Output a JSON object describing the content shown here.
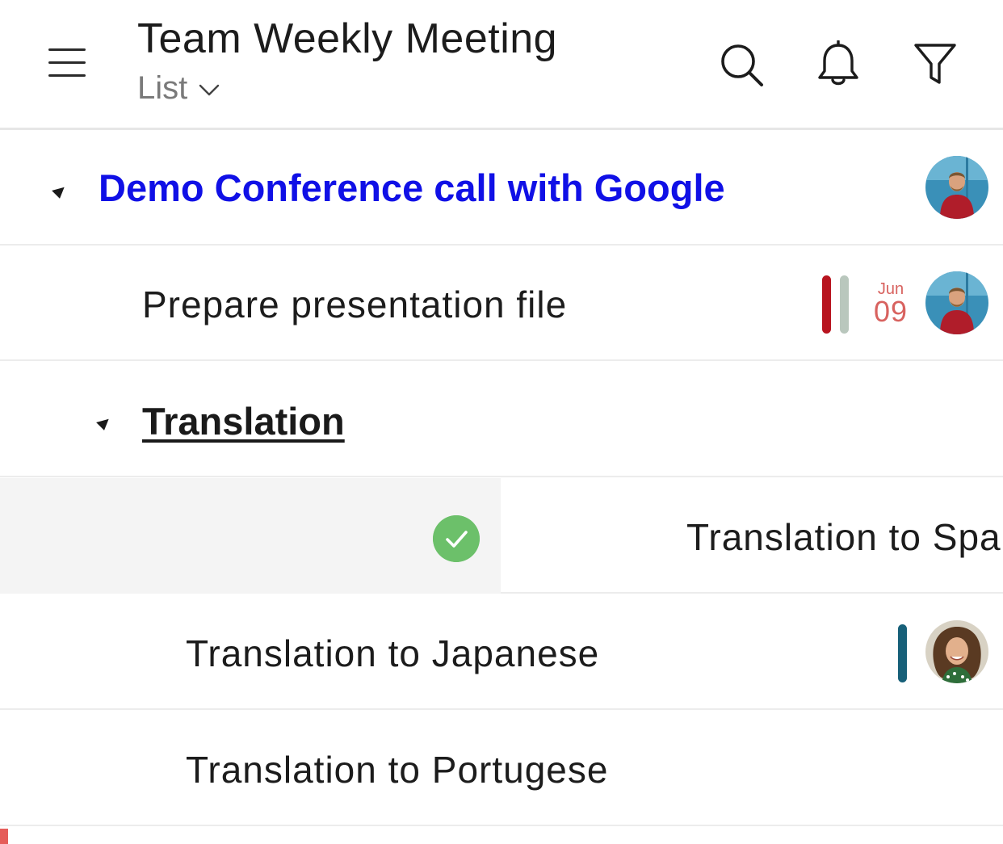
{
  "header": {
    "title": "Team Weekly Meeting",
    "view_label": "List",
    "icons": [
      "menu-icon",
      "search-icon",
      "bell-icon",
      "filter-icon"
    ]
  },
  "rows": [
    {
      "type": "group",
      "label": "Demo Conference call with Google",
      "color": "#1010e6",
      "avatar": "man-red-sweater"
    },
    {
      "type": "task",
      "label": "Prepare presentation file",
      "date_month": "Jun",
      "date_day": "09",
      "tags": [
        "#b8141f",
        "#b9c7bd"
      ],
      "avatar": "man-red-sweater"
    },
    {
      "type": "group",
      "label": "Translation",
      "underlined": true
    },
    {
      "type": "task",
      "label": "Translation to Spa",
      "swiped": true,
      "action": "complete"
    },
    {
      "type": "task",
      "label": "Translation to Japanese",
      "tags": [
        "#176079"
      ],
      "avatar": "woman-curly-hair"
    },
    {
      "type": "task",
      "label": "Translation to Portugese"
    }
  ],
  "colors": {
    "accent_blue": "#1010e6",
    "date_red": "#d8625f",
    "complete_green": "#6cc06a"
  }
}
